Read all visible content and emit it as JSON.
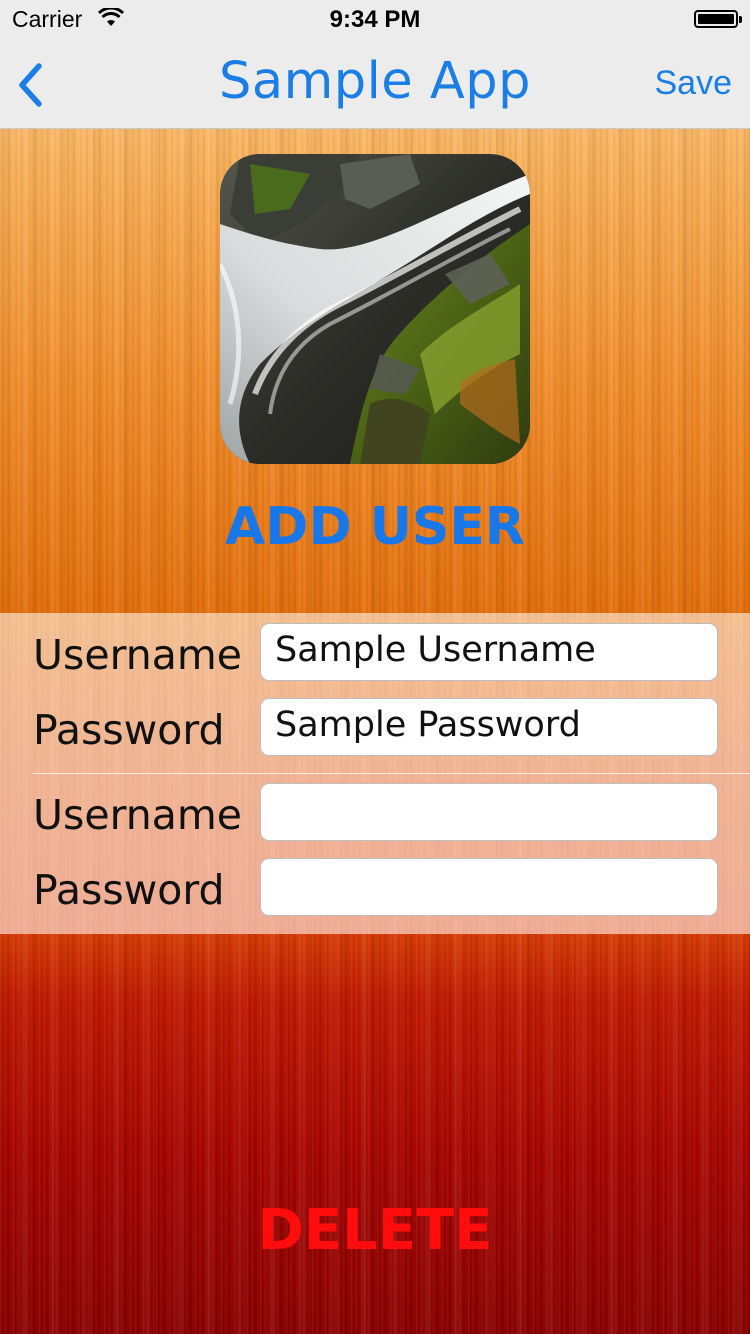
{
  "status_bar": {
    "carrier": "Carrier",
    "time": "9:34 PM"
  },
  "nav": {
    "title": "Sample App",
    "save_label": "Save",
    "back_icon": "chevron-left-icon"
  },
  "avatar": {
    "icon": "waterfall-photo"
  },
  "heading": "ADD USER",
  "form": {
    "groups": [
      {
        "username_label": "Username",
        "username_value": "Sample Username",
        "password_label": "Password",
        "password_value": "Sample Password"
      },
      {
        "username_label": "Username",
        "username_value": "",
        "password_label": "Password",
        "password_value": ""
      }
    ]
  },
  "delete_label": "DELETE",
  "colors": {
    "accent": "#1a7ee6",
    "delete": "#ff0d0d"
  }
}
